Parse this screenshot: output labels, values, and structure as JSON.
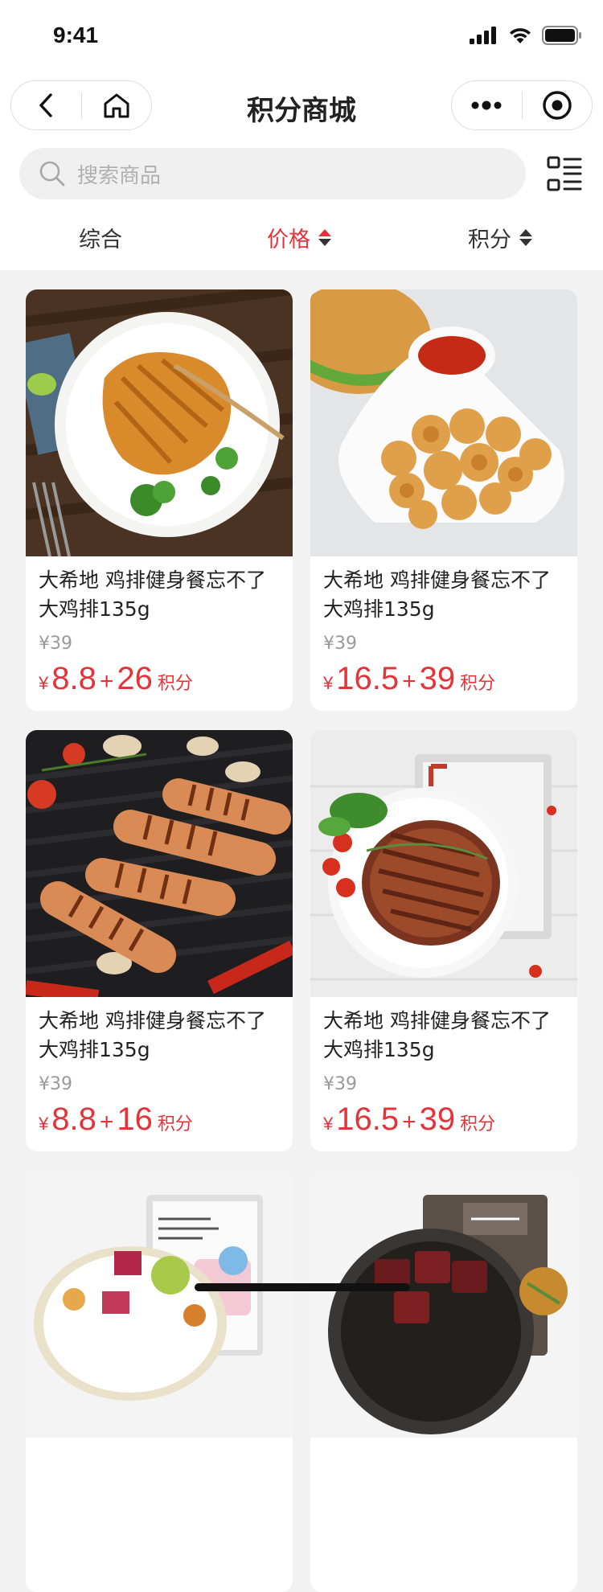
{
  "status": {
    "time": "9:41"
  },
  "nav": {
    "title": "积分商城"
  },
  "search": {
    "placeholder": "搜索商品"
  },
  "sort": {
    "items": [
      "综合",
      "价格",
      "积分"
    ],
    "active_index": 1
  },
  "colors": {
    "accent": "#e5333a",
    "text": "#222222",
    "muted": "#9a9a9a",
    "page_bg": "#f2f2f2"
  },
  "products": [
    {
      "name": "大希地 鸡排健身餐忘不了大鸡排135g",
      "orig": "¥39",
      "yen": "¥",
      "price": "8.8",
      "plus": "+",
      "points": "26",
      "points_unit": "积分",
      "image": "grilled-chicken-steak"
    },
    {
      "name": "大希地 鸡排健身餐忘不了大鸡排135g",
      "orig": "¥39",
      "yen": "¥",
      "price": "16.5",
      "plus": "+",
      "points": "39",
      "points_unit": "积分",
      "image": "chicken-nuggets-burger"
    },
    {
      "name": "大希地 鸡排健身餐忘不了大鸡排135g",
      "orig": "¥39",
      "yen": "¥",
      "price": "8.8",
      "plus": "+",
      "points": "16",
      "points_unit": "积分",
      "image": "grilled-sausages"
    },
    {
      "name": "大希地 鸡排健身餐忘不了大鸡排135g",
      "orig": "¥39",
      "yen": "¥",
      "price": "16.5",
      "plus": "+",
      "points": "39",
      "points_unit": "积分",
      "image": "beef-steak-package"
    },
    {
      "image": "chicken-breast-salad"
    },
    {
      "image": "beef-cubes-pan"
    }
  ]
}
